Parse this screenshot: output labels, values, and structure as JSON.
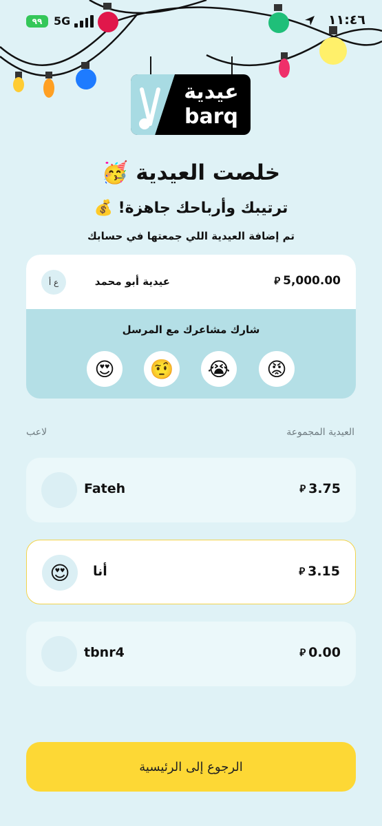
{
  "status_bar": {
    "time": "١١:٤٦",
    "network": "5G",
    "battery": "٩٩"
  },
  "logo": {
    "arabic": "عيدية",
    "english": "barq"
  },
  "header": {
    "title": "خلصت العيدية 🥳",
    "subtitle": "ترتيبك وأرباحك جاهزة! 💰",
    "description": "تم إضافة العيدية اللي جمعتها في حسابك"
  },
  "gift": {
    "sender_initials": "ع أ",
    "sender": "عيدية أبو محمد",
    "amount": "5,000.00",
    "currency_symbol": "⃁",
    "share_label": "شارك مشاعرك مع المرسل",
    "reactions": [
      {
        "emoji": "😍",
        "icon": "heart-eyes-emoji-icon"
      },
      {
        "emoji": "🤨",
        "icon": "raised-eyebrow-emoji-icon"
      },
      {
        "emoji": "😭",
        "icon": "crying-emoji-icon"
      },
      {
        "emoji": "😡",
        "icon": "angry-emoji-icon"
      }
    ]
  },
  "leaderboard": {
    "col_player": "لاعب",
    "col_collected": "العيدية المجموعة",
    "rows": [
      {
        "name": "Fateh",
        "amount": "3.75",
        "avatar": ""
      },
      {
        "name": "أنا",
        "amount": "3.15",
        "avatar": "😍",
        "is_me": true
      },
      {
        "name": "tbnr4",
        "amount": "0.00",
        "avatar": ""
      }
    ]
  },
  "cta": {
    "label": "الرجوع إلى الرئيسية"
  },
  "colors": {
    "background": "#dff2f6",
    "accent_yellow": "#fdd835",
    "battery_green": "#34c759"
  }
}
